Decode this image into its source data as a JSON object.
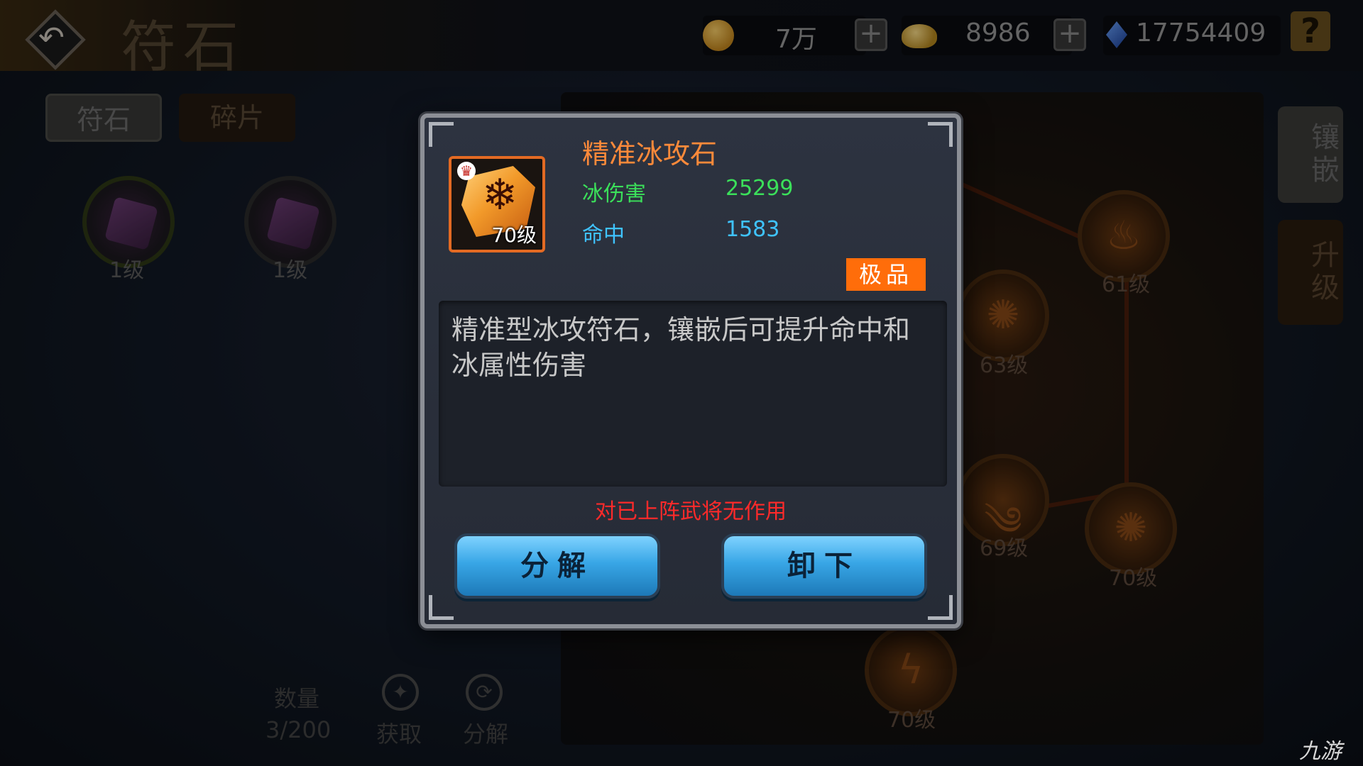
{
  "header": {
    "title": "符石",
    "resources": {
      "coins": "7万",
      "ingots": "8986",
      "gems": "17754409"
    },
    "help": "?"
  },
  "tabs": [
    "符石",
    "碎片"
  ],
  "left_runes": [
    {
      "level": "1级"
    },
    {
      "level": "1级"
    }
  ],
  "bottom": {
    "quantity_label": "数量",
    "quantity_value": "3/200",
    "obtain_label": "获取",
    "decompose_label": "分解"
  },
  "side_buttons": [
    "镶嵌",
    "升级"
  ],
  "right_runes": [
    {
      "level": "61级"
    },
    {
      "level": "63级"
    },
    {
      "level": "69级"
    },
    {
      "level": "70级"
    },
    {
      "level": "70级"
    }
  ],
  "modal": {
    "item_name": "精准冰攻石",
    "item_level": "70级",
    "stats": [
      {
        "name": "冰伤害",
        "value": "25299"
      },
      {
        "name": "命中",
        "value": "1583"
      }
    ],
    "grade": "极品",
    "description": "精准型冰攻符石，镶嵌后可提升命中和冰属性伤害",
    "warning": "对已上阵武将无作用",
    "buttons": {
      "decompose": "分解",
      "unequip": "卸下"
    }
  },
  "watermark": "九游",
  "colors": {
    "item_name": "#ff8a3a",
    "stat_fire": "#3be05a",
    "stat_hit": "#3fc3ff",
    "grade": "#ff6d0a",
    "warning": "#ff2a2a",
    "button": "#38a6e6"
  }
}
